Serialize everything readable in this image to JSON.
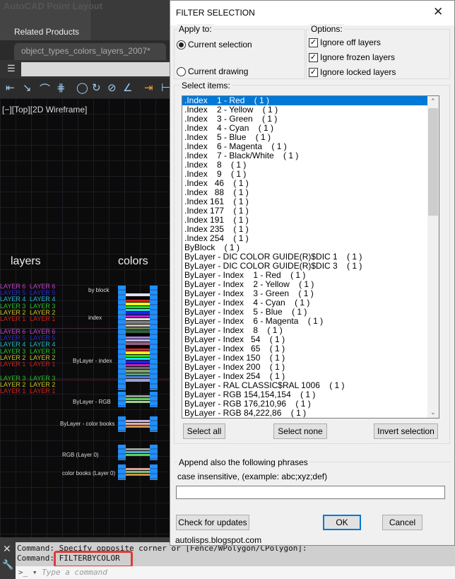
{
  "app": {
    "title": "AutoCAD Point Layout",
    "ribbon_tab": "Related Products",
    "doc_tab": "object_types_colors_layers_2007*",
    "view_label": "[−][Top][2D Wireframe]"
  },
  "drawing": {
    "heading_layers": "layers",
    "heading_colors": "colors",
    "layer_groups": [
      [
        {
          "name": "LAYER 6",
          "color": "#c040c8"
        },
        {
          "name": "LAYER 5",
          "color": "#2828c8"
        },
        {
          "name": "LAYER 4",
          "color": "#20b8c8"
        },
        {
          "name": "LAYER 3",
          "color": "#28c028"
        },
        {
          "name": "LAYER 2",
          "color": "#c8c028"
        },
        {
          "name": "LAYER 1",
          "color": "#c82020"
        }
      ],
      [
        {
          "name": "LAYER 6",
          "color": "#c040c8"
        },
        {
          "name": "LAYER 5",
          "color": "#2828c8"
        },
        {
          "name": "LAYER 4",
          "color": "#20b8c8"
        },
        {
          "name": "LAYER 3",
          "color": "#28c028"
        },
        {
          "name": "LAYER 2",
          "color": "#c8c028"
        },
        {
          "name": "LAYER 1",
          "color": "#c82020"
        }
      ],
      [
        {
          "name": "LAYER 3",
          "color": "#28c028"
        },
        {
          "name": "LAYER 2",
          "color": "#c8c028"
        },
        {
          "name": "LAYER 1",
          "color": "#c82020"
        }
      ]
    ],
    "labels": [
      "by block",
      "index",
      "ByLayer - index",
      "ByLayer - RGB",
      "ByLayer - color books",
      "RGB (Layer 0)",
      "color books (Layer 0)"
    ],
    "blocks": [
      [
        "#e0e0f0",
        "#000",
        "#e02020",
        "#f0f020",
        "#20e020",
        "#20e0e0",
        "#2020e0",
        "#c020c0",
        "#e0e0e0",
        "#808080",
        "#c0c0c0",
        "#708050",
        "#306040",
        "#000",
        "#a080e0",
        "#c0c0e0",
        "#906080",
        "#000",
        "#e02020",
        "#f0f020",
        "#20e020",
        "#20e0e0",
        "#2020e0",
        "#c020c0",
        "#707070",
        "#80a070",
        "#60a080",
        "#5080e0",
        "#a0a0d0"
      ],
      [
        "#9a9a9a",
        "#60d060",
        "#a0d090"
      ],
      [
        "#c8b0e0",
        "#e0b0a0",
        "#d09050"
      ],
      [
        "#9aa0a0",
        "#50b0d0",
        "#60d060"
      ],
      [
        "#e0a0a0",
        "#80c080",
        "#d09040"
      ]
    ]
  },
  "command": {
    "line1": "Command: Specify opposite corner or [Fence/WPolygon/CPolygon]:",
    "line2_prefix": "Command: ",
    "line2_cmd": "FILTERBYCOLOR",
    "placeholder": "Type a command"
  },
  "dialog": {
    "title": "FILTER SELECTION",
    "apply_to": {
      "label": "Apply to:",
      "options": [
        {
          "label": "Current selection",
          "checked": true
        },
        {
          "label": "Current drawing",
          "checked": false
        }
      ]
    },
    "options": {
      "label": "Options:",
      "items": [
        {
          "label": "Ignore off layers",
          "checked": true
        },
        {
          "label": "Ignore frozen layers",
          "checked": true
        },
        {
          "label": "Ignore locked layers",
          "checked": true
        }
      ]
    },
    "select_items_label": "Select items:",
    "items": [
      ".Index    1 - Red    ( 1 )",
      ".Index    2 - Yellow    ( 1 )",
      ".Index    3 - Green    ( 1 )",
      ".Index    4 - Cyan    ( 1 )",
      ".Index    5 - Blue    ( 1 )",
      ".Index    6 - Magenta    ( 1 )",
      ".Index    7 - Black/White    ( 1 )",
      ".Index    8    ( 1 )",
      ".Index    9    ( 1 )",
      ".Index   46    ( 1 )",
      ".Index   88    ( 1 )",
      ".Index 161    ( 1 )",
      ".Index 177    ( 1 )",
      ".Index 191    ( 1 )",
      ".Index 235    ( 1 )",
      ".Index 254    ( 1 )",
      "ByBlock    ( 1 )",
      "ByLayer - DIC COLOR GUIDE(R)$DIC 1    ( 1 )",
      "ByLayer - DIC COLOR GUIDE(R)$DIC 3    ( 1 )",
      "ByLayer - Index    1 - Red    ( 1 )",
      "ByLayer - Index    2 - Yellow    ( 1 )",
      "ByLayer - Index    3 - Green    ( 1 )",
      "ByLayer - Index    4 - Cyan    ( 1 )",
      "ByLayer - Index    5 - Blue    ( 1 )",
      "ByLayer - Index    6 - Magenta    ( 1 )",
      "ByLayer - Index    8    ( 1 )",
      "ByLayer - Index   54    ( 1 )",
      "ByLayer - Index   65    ( 1 )",
      "ByLayer - Index 150    ( 1 )",
      "ByLayer - Index 200    ( 1 )",
      "ByLayer - Index 254    ( 1 )",
      "ByLayer - RAL CLASSIC$RAL 1006    ( 1 )",
      "ByLayer - RGB 154,154,154    ( 1 )",
      "ByLayer - RGB 176,210,96    ( 1 )",
      "ByLayer - RGB 84,222,86    ( 1 )"
    ],
    "selected_index": 0,
    "select_all": "Select all",
    "select_none": "Select none",
    "invert": "Invert selection",
    "append_label": "Append also the following phrases",
    "append_hint": "case insensitive, (example:  abc;xyz;def)",
    "append_value": "",
    "check_updates": "Check for updates",
    "ok": "OK",
    "cancel": "Cancel",
    "footer": "autolisps.blogspot.com"
  }
}
